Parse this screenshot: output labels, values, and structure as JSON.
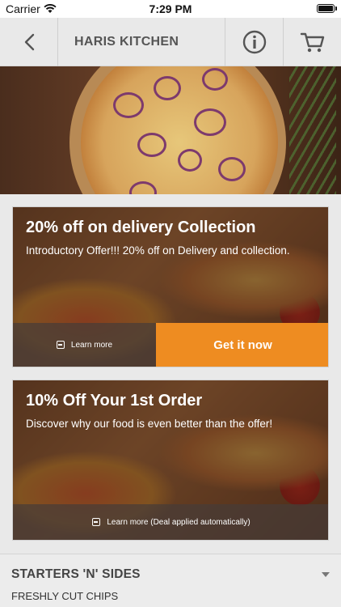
{
  "status_bar": {
    "carrier": "Carrier",
    "time": "7:29 PM"
  },
  "nav": {
    "title": "HARIS KITCHEN"
  },
  "offers": [
    {
      "title": "20% off on delivery Collection",
      "description": "Introductory Offer!!! 20% off on Delivery and collection.",
      "learn_more": "Learn more",
      "cta": "Get it now"
    },
    {
      "title": "10% Off Your 1st Order",
      "description": "Discover why our food is even better than the offer!",
      "learn_more": "Learn more (Deal applied automatically)"
    }
  ],
  "menu": {
    "category": "STARTERS 'N' SIDES",
    "first_item": "FRESHLY CUT CHIPS"
  },
  "colors": {
    "accent": "#ee8c21",
    "nav_bg": "#e8e8e8"
  }
}
